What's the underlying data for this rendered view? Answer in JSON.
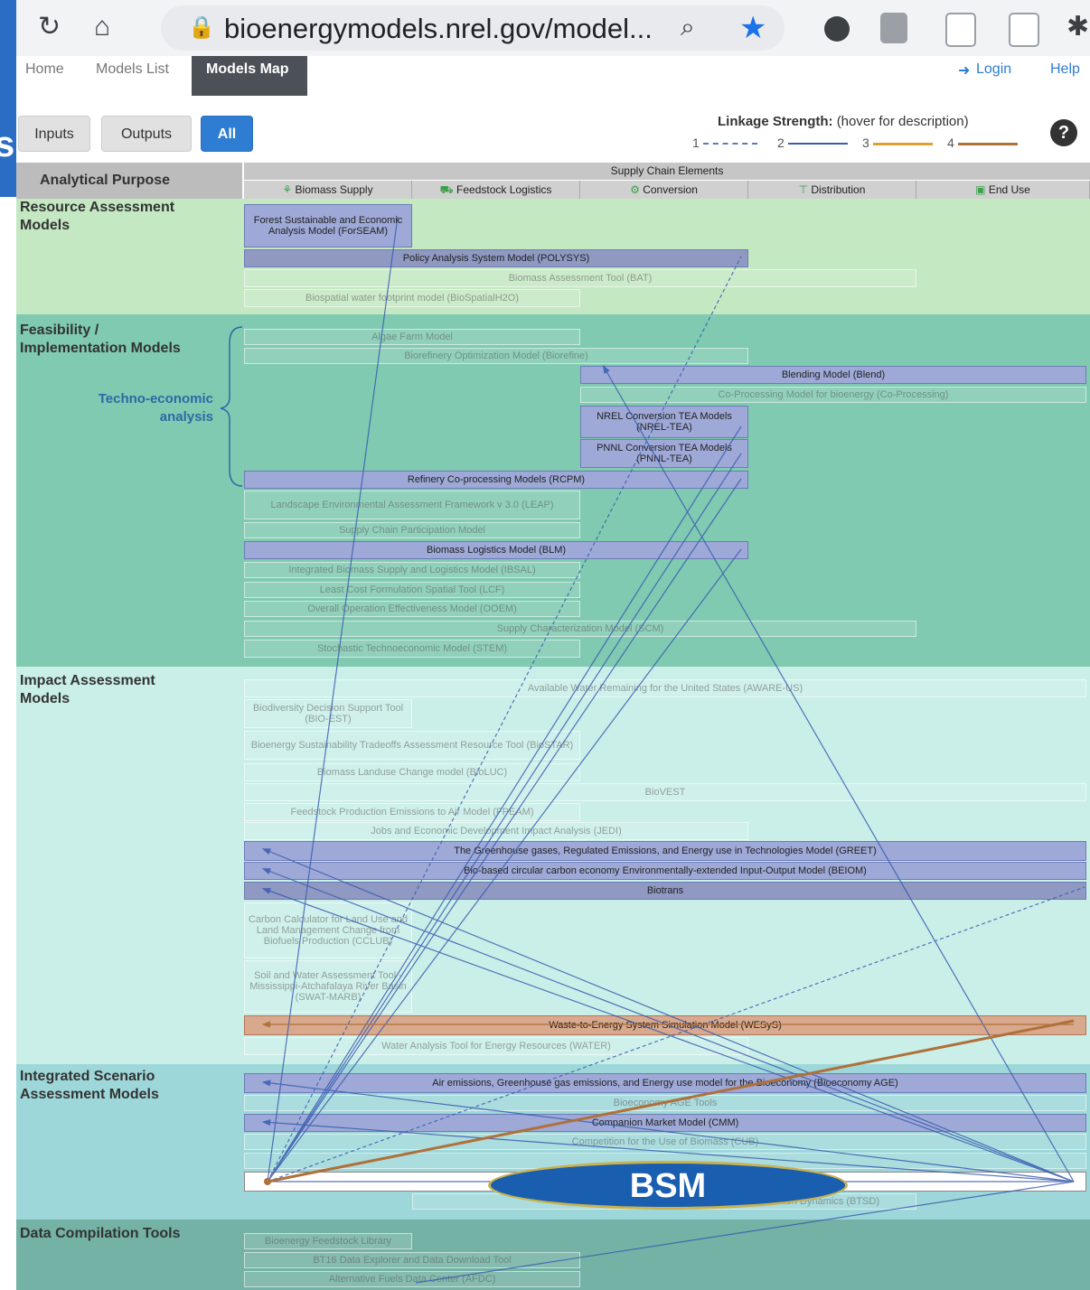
{
  "browser": {
    "url": "bioenergymodels.nrel.gov/model...",
    "icons": [
      "reload-icon",
      "home-icon",
      "lock-icon",
      "zoom-icon",
      "star-icon"
    ]
  },
  "side_text": "s",
  "nav": {
    "home": "Home",
    "models_list": "Models List",
    "models_map": "Models Map",
    "login": "Login",
    "help": "Help"
  },
  "filters": {
    "inputs": "Inputs",
    "outputs": "Outputs",
    "all": "All"
  },
  "legend": {
    "title": "Linkage Strength:",
    "hint": "(hover for description)",
    "levels": [
      {
        "label": "1",
        "color": "#5a78c0"
      },
      {
        "label": "2",
        "color": "#3a5cb0"
      },
      {
        "label": "3",
        "color": "#e0a030"
      },
      {
        "label": "4",
        "color": "#b0703a"
      }
    ]
  },
  "header": {
    "analytical_purpose": "Analytical Purpose",
    "supply_chain": "Supply Chain Elements",
    "columns": [
      "Biomass Supply",
      "Feedstock Logistics",
      "Conversion",
      "Distribution",
      "End Use"
    ]
  },
  "sections": {
    "resource": "Resource Assessment Models",
    "feasibility": "Feasibility / Implementation Models",
    "techno": "Techno-economic analysis",
    "impact": "Impact Assessment Models",
    "integrated": "Integrated Scenario Assessment Models",
    "data": "Data Compilation Tools"
  },
  "models": {
    "forseam": "Forest Sustainable and Economic Analysis Model (ForSEAM)",
    "polysys": "Policy Analysis System Model (POLYSYS)",
    "bat": "Biomass Assessment Tool (BAT)",
    "biospatial": "Biospatial water footprint model (BioSpatialH2O)",
    "algae": "Algae Farm Model",
    "biorefine": "Biorefinery Optimization Model (Biorefine)",
    "blend": "Blending Model (Blend)",
    "coproc": "Co-Processing Model for bioenergy (Co-Processing)",
    "nrel_tea": "NREL Conversion TEA Models (NREL-TEA)",
    "pnnl_tea": "PNNL Conversion TEA Models (PNNL-TEA)",
    "rcpm": "Refinery Co-processing Models (RCPM)",
    "leap": "Landscape Environmental Assessment Framework v 3.0 (LEAP)",
    "scpm": "Supply Chain Participation Model",
    "blm": "Biomass Logistics Model (BLM)",
    "ibsal": "Integrated Biomass Supply and Logistics Model (IBSAL)",
    "lcf": "Least Cost Formulation Spatial Tool (LCF)",
    "ooem": "Overall Operation Effectiveness Model (OOEM)",
    "scm": "Supply Characterization Model (SCM)",
    "stem": "Stochastic Technoeconomic Model (STEM)",
    "aware": "Available Water Remaining for the United States (AWARE-US)",
    "biodss": "Biodiversity Decision Support Tool (BIO-EST)",
    "biostar": "Bioenergy Sustainability Tradeoffs Assessment Resource Tool (BioSTAR)",
    "biolu": "Biomass Landuse Change model (BioLUC)",
    "biovest": "BioVEST",
    "fpeam": "Feedstock Production Emissions to Air Model (FPEAM)",
    "jedi": "Jobs and Economic Development Impact Analysis (JEDI)",
    "greet": "The Greenhouse gases, Regulated Emissions, and Energy use in Technologies Model (GREET)",
    "beiom": "Bio-based circular carbon economy Environmentally-extended Input-Output Model (BEIOM)",
    "biotrans": "Biotrans",
    "cclub": "Carbon Calculator for Land Use and Land Management Change from Biofuels Production (CCLUB)",
    "swat": "Soil and Water Assessment Tool - Mississippi-Atchafalaya River Basin (SWAT-MARB)",
    "wesys": "Waste-to-Energy System Simulation Model (WESyS)",
    "waters": "Water Analysis Tool for Energy Resources (WATER)",
    "age": "Air emissions, Greenhouse gas emissions, and Energy use model for the Bioeconomy (Bioeconomy AGE)",
    "bioeconomy_tools": "Bioeconomy AGE Tools",
    "cmm": "Companion Market Model (CMM)",
    "cub": "Competition for the Use of Biomass (CUB)",
    "btsd": "Biomass Transition Dynamics (BTSD)",
    "bfl": "Bioenergy Feedstock Library",
    "bt16": "BT16 Data Explorer and Data Download Tool",
    "afdc": "Alternative Fuels Data Center (AFDC)"
  },
  "bsm_label": "BSM",
  "colors": {
    "resource_bg": "#c4e8c2",
    "feasibility_bg": "#7fcab0",
    "impact_bg": "#c9efe8",
    "integrated_bg": "#9ed7d9",
    "data_bg": "#73b2a4",
    "active_box": "#9ea9d7",
    "wesys_box": "#d8a98d",
    "bsm_oval": "#1a5eaf"
  }
}
